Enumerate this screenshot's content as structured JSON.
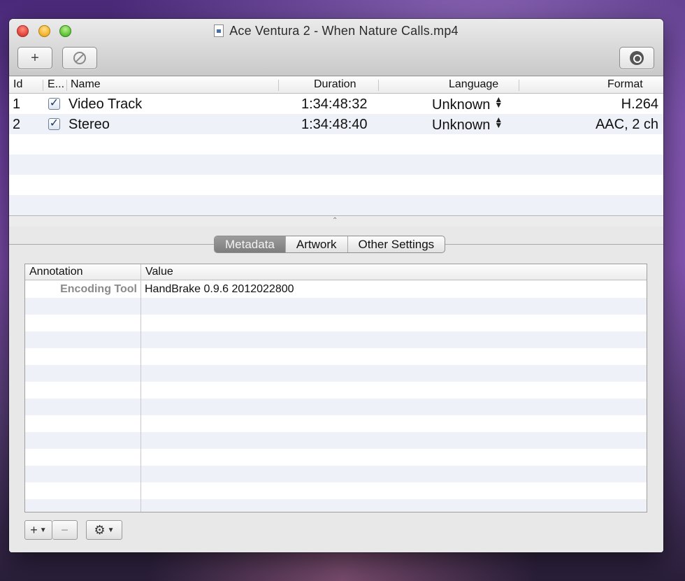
{
  "window": {
    "title": "Ace Ventura 2 - When Nature Calls.mp4"
  },
  "toolbar": {
    "add_label": "+"
  },
  "tracks": {
    "headers": {
      "id": "Id",
      "enabled": "E...",
      "name": "Name",
      "duration": "Duration",
      "language": "Language",
      "format": "Format"
    },
    "rows": [
      {
        "id": "1",
        "enabled": true,
        "name": "Video Track",
        "duration": "1:34:48:32",
        "language": "Unknown",
        "format": "H.264"
      },
      {
        "id": "2",
        "enabled": true,
        "name": "Stereo",
        "duration": "1:34:48:40",
        "language": "Unknown",
        "format": "AAC, 2 ch"
      }
    ]
  },
  "tabs": [
    {
      "label": "Metadata",
      "active": true
    },
    {
      "label": "Artwork",
      "active": false
    },
    {
      "label": "Other Settings",
      "active": false
    }
  ],
  "metadata": {
    "headers": {
      "annotation": "Annotation",
      "value": "Value"
    },
    "rows": [
      {
        "key": "Encoding Tool",
        "value": "HandBrake 0.9.6 2012022800"
      }
    ]
  },
  "bottom_bar": {
    "add_label": "+",
    "remove_label": "−"
  },
  "icons": {
    "remove": "no-entry-icon",
    "search": "magnifier-icon",
    "gear": "gear-icon"
  }
}
